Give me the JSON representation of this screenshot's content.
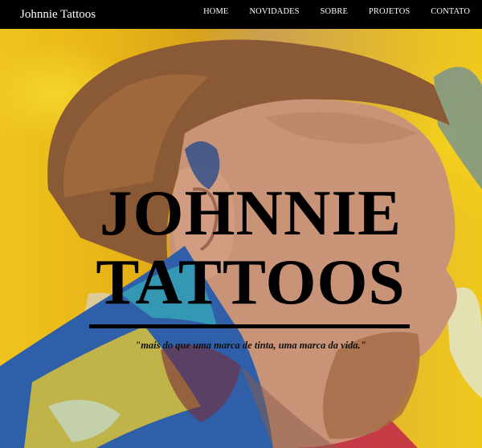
{
  "navbar": {
    "brand": "Johnnie Tattoos",
    "links": [
      "HOME",
      "NOVIDADES",
      "SOBRE",
      "PROJETOS",
      "CONTATO"
    ]
  },
  "hero": {
    "title_line1": "JOHNNIE",
    "title_line2": "TATTOOS",
    "tagline": "\"mais do que uma marca de tinta, uma marca da vida.\""
  },
  "colors": {
    "navbar_bg": "#000000",
    "nav_text": "#ffffff",
    "hero_bg": "#e8c21c",
    "title_text": "#000000"
  }
}
